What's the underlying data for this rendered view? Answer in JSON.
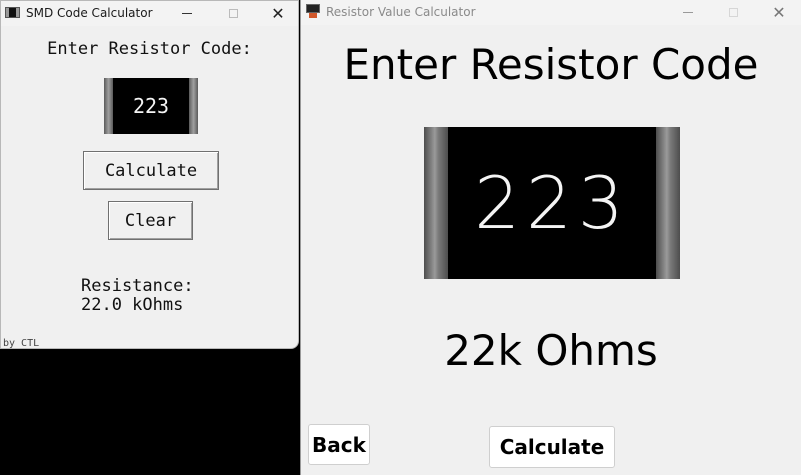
{
  "smd_window": {
    "title": "SMD Code Calculator",
    "icon": "resistor-chip-icon",
    "controls": {
      "minimize": "minimize-icon",
      "maximize": "maximize-icon",
      "close": "✕"
    },
    "prompt": "Enter Resistor Code:",
    "code": "223",
    "calculate_label": "Calculate",
    "clear_label": "Clear",
    "result_label": "Resistance:",
    "result_value": "22.0 kOhms",
    "credit": "by CTL"
  },
  "resistor_window": {
    "title": "Resistor Value Calculator",
    "icon": "resistor-app-icon",
    "controls": {
      "minimize": "minimize-icon",
      "maximize": "maximize-icon",
      "close": "✕"
    },
    "prompt": "Enter Resistor Code",
    "code": "223",
    "result": "22k Ohms",
    "back_label": "Back",
    "calculate_label": "Calculate"
  },
  "colors": {
    "window_bg": "#f0f0f0",
    "desktop": "#000000",
    "chip_body": "#000000",
    "chip_text": "#f4f4f4",
    "accent_icon": "#d0572b"
  }
}
